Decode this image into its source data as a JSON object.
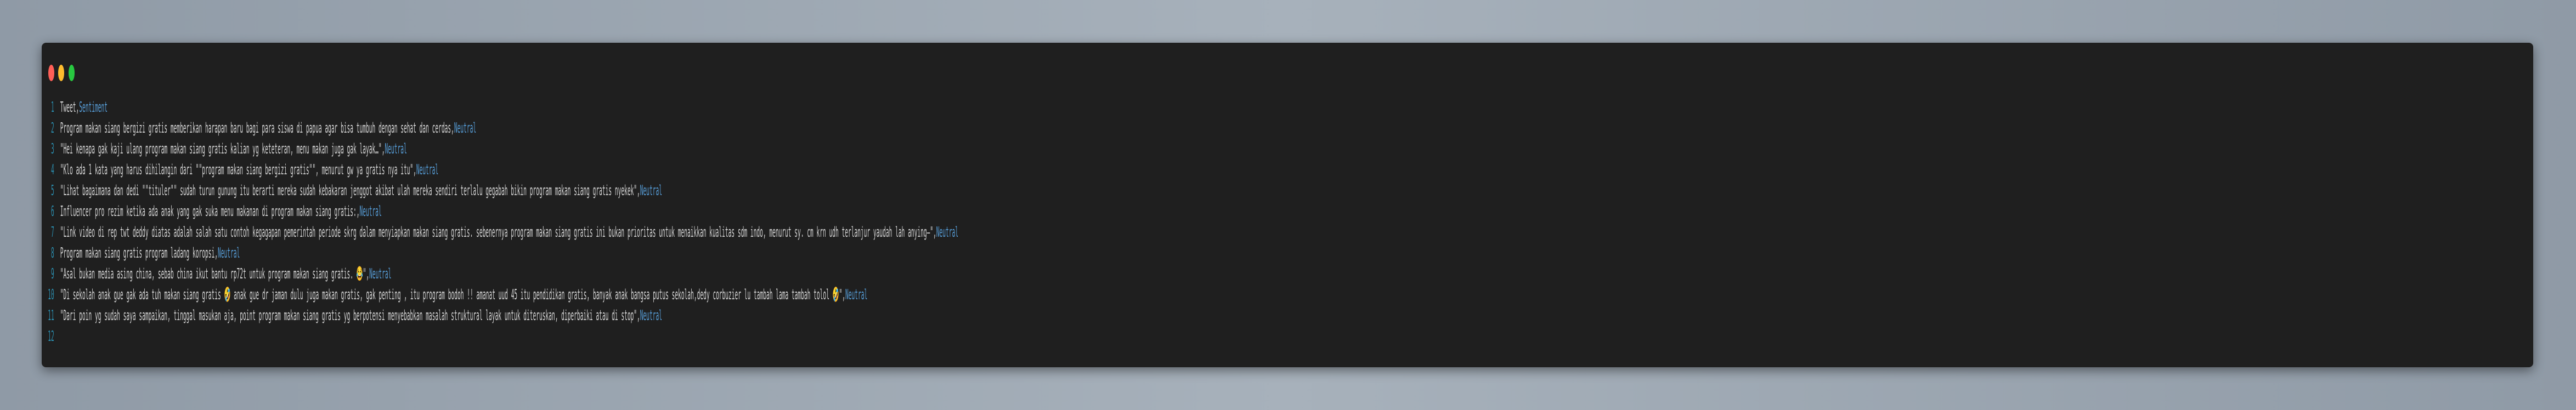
{
  "window": {
    "controls": [
      "close",
      "minimize",
      "maximize"
    ]
  },
  "colors": {
    "text": "#d4d4d4",
    "sentiment": "#569cd6",
    "line_number": "#2b8fb0",
    "background": "#1f1f1f"
  },
  "lines": [
    {
      "num": "1",
      "text": "Tweet,",
      "label": "Sentiment"
    },
    {
      "num": "2",
      "text": "Program makan siang bergizi gratis memberikan harapan baru bagi para siswa di papua agar bisa tumbuh dengan sehat dan cerdas,",
      "label": "Neutral"
    },
    {
      "num": "3",
      "text": "\"Hei kenapa gak kaji ulang program makan siang gratis kalian yg keteteran, menu makan juga gak layak…\",",
      "label": "Neutral"
    },
    {
      "num": "4",
      "text": "\"Klo ada 1 kata yang harus dihilangin dari \"\"program makan siang bergizi gratis\"\", menurut gw ya gratis nya itu\",",
      "label": "Neutral"
    },
    {
      "num": "5",
      "text": "\"Lihat bagaimana dan dedi \"\"tituler\"\" sudah turun gunung itu berarti mereka sudah kebakaran jenggot akibat ulah mereka sendiri terlalu gegabah bikin program makan siang gratis nyekek\",",
      "label": "Neutral"
    },
    {
      "num": "6",
      "text": "Influencer pro rezim ketika ada anak yang gak suka menu makanan di program makan siang gratis:,",
      "label": "Neutral"
    },
    {
      "num": "7",
      "text": "\"Link video di rep twt deddy diatas adalah salah satu contoh kegagapan pemerintah periode skrg dalam menyiapkan makan siang gratis. sebenernya program makan siang gratis ini bukan prioritas untuk menaikkan kualitas sdm indo, menurut sy. cm krn udh terlanjur yaudah lah anying–\",",
      "label": "Neutral"
    },
    {
      "num": "8",
      "text": "Program makan siang gratis program ladang koropsi,",
      "label": "Neutral"
    },
    {
      "num": "9",
      "text": "\"Asal bukan media asing china, sebab china ikut bantu rp72t untuk program makan siang gratis. 😂\",",
      "label": "Neutral"
    },
    {
      "num": "10",
      "text": "\"Di sekolah anak gue gak ada tuh makan siang gratis 🤣 anak gue dr jaman dulu juga makan gratis, gak penting , itu program bodoh !! amanat uud 45 itu pendidikan gratis, banyak anak bangsa putus sekolah,dedy corbuzier lu tambah lama tambah tolol 🤣\",",
      "label": "Neutral"
    },
    {
      "num": "11",
      "text": "\"Dari poin yg sudah saya sampaikan, tinggal masukan aja, point program makan siang gratis yg berpotensi menyebabkan masalah struktural layak untuk diteruskan, diperbaiki atau di stop\",",
      "label": "Neutral"
    },
    {
      "num": "12",
      "text": "",
      "label": ""
    }
  ]
}
